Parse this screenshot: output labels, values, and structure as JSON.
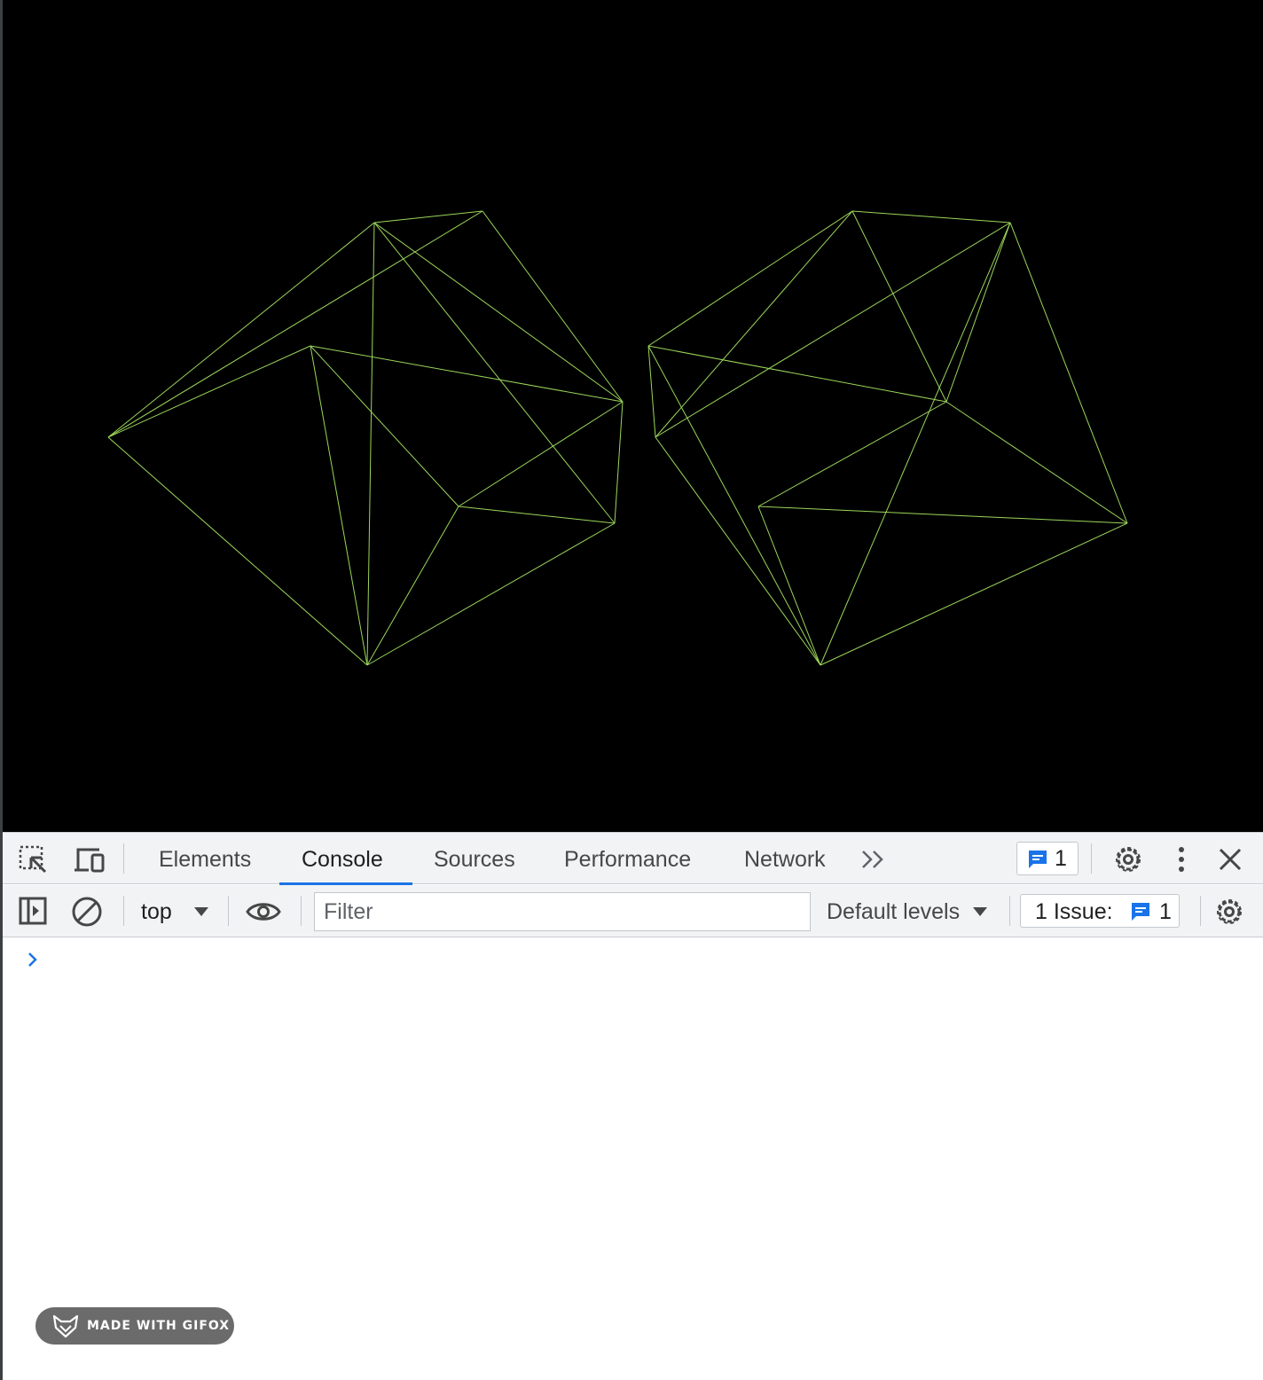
{
  "canvas": {
    "line_color": "#9bd65a",
    "background": "#000000"
  },
  "devtools": {
    "tabs": [
      {
        "label": "Elements",
        "active": false
      },
      {
        "label": "Console",
        "active": true
      },
      {
        "label": "Sources",
        "active": false
      },
      {
        "label": "Performance",
        "active": false
      },
      {
        "label": "Network",
        "active": false
      }
    ],
    "messages_count": "1",
    "toolbar": {
      "context": "top",
      "filter_placeholder": "Filter",
      "levels_label": "Default levels",
      "issues_label": "1 Issue:",
      "issues_count": "1"
    },
    "console_prompt": "›",
    "accent_color": "#1a73e8"
  },
  "watermark": {
    "label": "MADE WITH GIFOX"
  }
}
